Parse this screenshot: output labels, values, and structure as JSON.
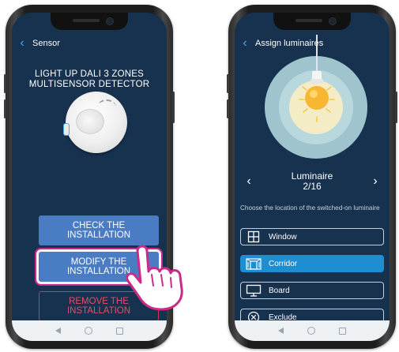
{
  "left_screen": {
    "header_title": "Sensor",
    "product_title_line1": "LIGHT UP DALI 3 ZONES",
    "product_title_line2": "MULTISENSOR DETECTOR",
    "check_line1": "CHECK THE",
    "check_line2": "INSTALLATION",
    "modify_line1": "MODIFY THE",
    "modify_line2": "INSTALLATION",
    "remove_line1": "REMOVE THE",
    "remove_line2": "INSTALLATION"
  },
  "right_screen": {
    "header_title": "Assign luminaires",
    "luminaire_label": "Luminaire",
    "luminaire_counter": "2/16",
    "hint": "Choose the location of the switched-on luminaire",
    "locations": [
      {
        "label": "Window",
        "icon": "window-icon",
        "selected": false
      },
      {
        "label": "Corridor",
        "icon": "corridor-icon",
        "selected": true
      },
      {
        "label": "Board",
        "icon": "board-icon",
        "selected": false
      },
      {
        "label": "Exclude",
        "icon": "exclude-icon",
        "selected": false
      }
    ]
  },
  "colors": {
    "screen_bg": "#17324f",
    "primary_button": "#4a7cc4",
    "highlight_ring": "#cc2a8a",
    "danger": "#e14f6c",
    "selected": "#1d8fd0",
    "back_chevron": "#4aa8e8"
  }
}
